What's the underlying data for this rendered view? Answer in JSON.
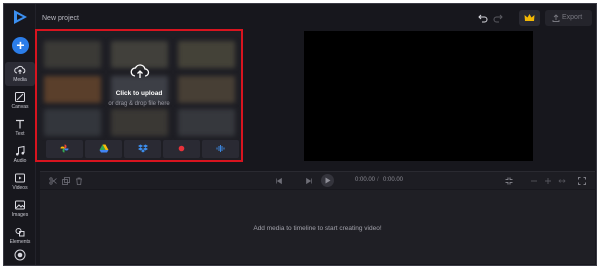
{
  "header": {
    "project_title": "New project",
    "export_label": "Export",
    "undo_icon": "undo-icon",
    "redo_icon": "redo-icon",
    "crown_icon": "crown-icon"
  },
  "sidebar": {
    "add_icon": "plus-icon",
    "items": [
      {
        "label": "Media",
        "icon": "cloud-icon",
        "active": true
      },
      {
        "label": "Canvas",
        "icon": "canvas-icon",
        "active": false
      },
      {
        "label": "Text",
        "icon": "text-icon",
        "active": false
      },
      {
        "label": "Audio",
        "icon": "music-icon",
        "active": false
      },
      {
        "label": "Videos",
        "icon": "video-icon",
        "active": false
      },
      {
        "label": "Images",
        "icon": "image-icon",
        "active": false
      },
      {
        "label": "Elements",
        "icon": "shapes-icon",
        "active": false
      }
    ]
  },
  "upload": {
    "title": "Click to upload",
    "subtitle": "or drag & drop file here",
    "sources": [
      "google-photos-icon",
      "google-drive-icon",
      "dropbox-icon",
      "record-icon",
      "audio-wave-icon"
    ]
  },
  "timeline": {
    "current_time": "0:00.00",
    "separator": "/",
    "total_time": "0:00.00",
    "empty_message": "Add media to timeline to start creating video!"
  },
  "colors": {
    "accent": "#2b7de9",
    "highlight": "#d8141f",
    "crown": "#f2b705",
    "background": "#17171d"
  }
}
